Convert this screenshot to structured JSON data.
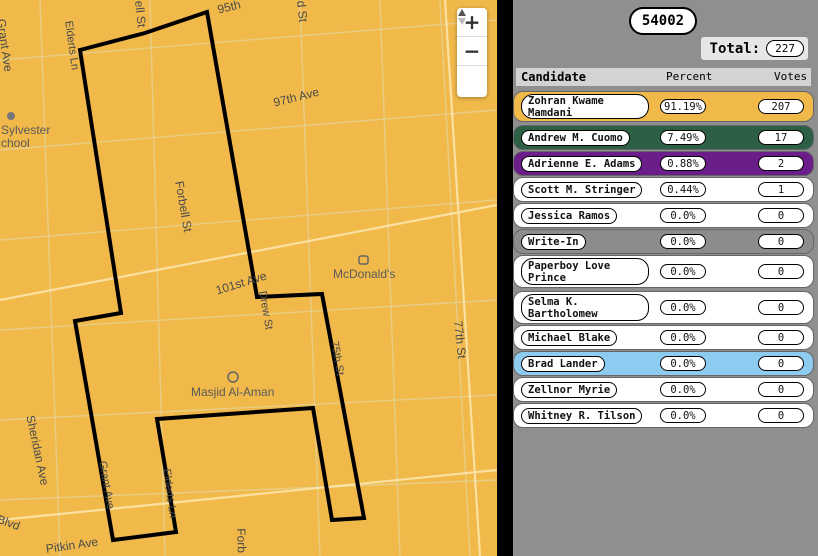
{
  "map": {
    "streets": [
      {
        "name": "Grant Ave",
        "key": "grant-ave-nw"
      },
      {
        "name": "Elderts Ln",
        "key": "elderts-ln-n"
      },
      {
        "name": "Forbell St",
        "key": "forbell-st-n"
      },
      {
        "name": "95th",
        "key": "95th"
      },
      {
        "name": "97th Ave",
        "key": "97th-ave"
      },
      {
        "name": "101st Ave",
        "key": "101st-ave"
      },
      {
        "name": "Drew St",
        "key": "drew-st"
      },
      {
        "name": "75th St",
        "key": "75th-st"
      },
      {
        "name": "77th St",
        "key": "77th-st"
      },
      {
        "name": "Sheridan Ave",
        "key": "sheridan-ave"
      },
      {
        "name": "Grant Ave",
        "key": "grant-ave-s"
      },
      {
        "name": "Elderts Ln",
        "key": "elderts-ln-s"
      },
      {
        "name": "Pitkin Ave",
        "key": "pitkin-ave"
      },
      {
        "name": "Blvd",
        "key": "blvd"
      },
      {
        "name": "Forb",
        "key": "forb"
      },
      {
        "name": "ell St",
        "key": "ell-st"
      },
      {
        "name": "d St",
        "key": "d-st"
      }
    ],
    "pois": {
      "school": "Sylvester\nchool",
      "mcdonalds": "McDonald's",
      "mosque": "Masjid Al-Aman"
    },
    "zoom": {
      "plus": "+",
      "minus": "−",
      "compass": "▲▼"
    }
  },
  "panel": {
    "precinct": "54002",
    "total_label": "Total:",
    "total_votes": "227",
    "columns": {
      "candidate": "Candidate",
      "percent": "Percent",
      "votes": "Votes"
    },
    "candidates": [
      {
        "name": "Zohran Kwame Mamdani",
        "percent": "91.19%",
        "votes": "207",
        "color": "#f0b94a"
      },
      {
        "name": "Andrew M. Cuomo",
        "percent": "7.49%",
        "votes": "17",
        "color": "#2c5f44"
      },
      {
        "name": "Adrienne E. Adams",
        "percent": "0.88%",
        "votes": "2",
        "color": "#6b1d8a"
      },
      {
        "name": "Scott M. Stringer",
        "percent": "0.44%",
        "votes": "1",
        "color": "#ffffff"
      },
      {
        "name": "Jessica Ramos",
        "percent": "0.0%",
        "votes": "0",
        "color": "#ffffff"
      },
      {
        "name": "Write-In",
        "percent": "0.0%",
        "votes": "0",
        "color": "#8c8c8c"
      },
      {
        "name": "Paperboy Love Prince",
        "percent": "0.0%",
        "votes": "0",
        "color": "#ffffff"
      },
      {
        "name": "Selma K. Bartholomew",
        "percent": "0.0%",
        "votes": "0",
        "color": "#ffffff"
      },
      {
        "name": "Michael Blake",
        "percent": "0.0%",
        "votes": "0",
        "color": "#ffffff"
      },
      {
        "name": "Brad Lander",
        "percent": "0.0%",
        "votes": "0",
        "color": "#8ecbf0"
      },
      {
        "name": "Zellnor Myrie",
        "percent": "0.0%",
        "votes": "0",
        "color": "#ffffff"
      },
      {
        "name": "Whitney R. Tilson",
        "percent": "0.0%",
        "votes": "0",
        "color": "#ffffff"
      }
    ]
  }
}
